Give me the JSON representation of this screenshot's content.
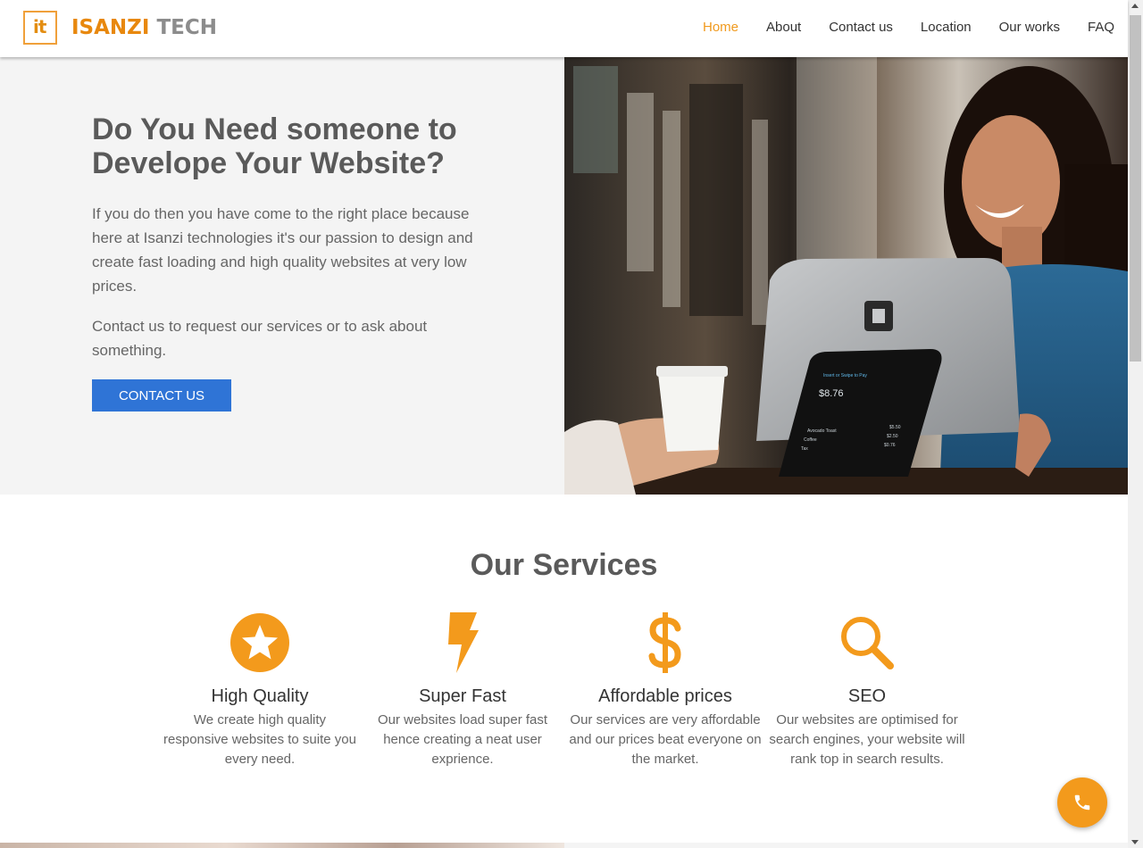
{
  "header": {
    "logo_text": "it",
    "brand_primary": "ISANZI",
    "brand_secondary": "TECH",
    "nav": [
      {
        "label": "Home",
        "active": true
      },
      {
        "label": "About",
        "active": false
      },
      {
        "label": "Contact us",
        "active": false
      },
      {
        "label": "Location",
        "active": false
      },
      {
        "label": "Our works",
        "active": false
      },
      {
        "label": "FAQ",
        "active": false
      }
    ]
  },
  "hero": {
    "title": "Do You Need someone to Develope Your Website?",
    "paragraph1": "If you do then you have come to the right place because here at Isanzi technologies it's our passion to design and create fast loading and high quality websites at very low prices.",
    "paragraph2": "Contact us to request our services or to ask about something.",
    "button_label": "CONTACT US",
    "image": {
      "screen_heading": "Insert or Swipe to Pay",
      "screen_total": "$8.76",
      "screen_items": [
        {
          "name": "Avocado Toast",
          "price": "$5.50"
        },
        {
          "name": "Coffee",
          "price": "$2.50"
        },
        {
          "name": "Tax",
          "price": "$0.76"
        }
      ]
    }
  },
  "services": {
    "title": "Our Services",
    "items": [
      {
        "icon": "star-circle-icon",
        "title": "High Quality",
        "description": "We create high quality responsive websites to suite you every need."
      },
      {
        "icon": "lightning-icon",
        "title": "Super Fast",
        "description": "Our websites load super fast hence creating a neat user exprience."
      },
      {
        "icon": "dollar-icon",
        "title": "Affordable prices",
        "description": "Our services are very affordable and our prices beat everyone on the market."
      },
      {
        "icon": "search-icon",
        "title": "SEO",
        "description": "Our websites are optimised for search engines, your website will rank top in search results."
      }
    ]
  },
  "fab": {
    "icon": "phone-icon"
  },
  "colors": {
    "accent": "#f39a1c",
    "button": "#2f74d6",
    "hero_bg": "#f4f4f4"
  }
}
